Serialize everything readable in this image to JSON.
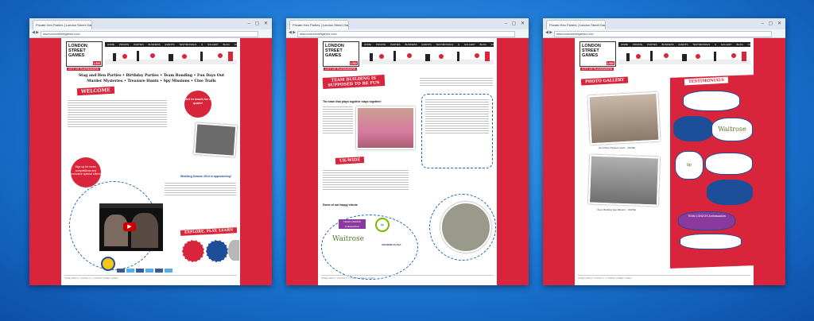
{
  "windows": [
    {
      "tab_title": "Private Hen Parties | London Street Games",
      "url": "www.londonstreetgames.com/",
      "nav": "HOME  PRIVATE PARTIES  BUSINESS EVENTS  TESTIMONIALS & GALLERY  BLOG  CONTACT",
      "logo": {
        "line1": "LONDON",
        "line2": "STREET",
        "line3": "GAMES",
        "badge": "LSG",
        "tagline": "CITY OF PLAYMAKERS"
      },
      "headline": "Stag and Hen Parties • Birthday Parties • Team Bonding • Fun Days Out",
      "headline2": "Murder Mysteries • Treasure Hunts • Spy Missions • Clue Trails",
      "welcome": "WELCOME",
      "get_in_touch": "Get in touch for a quote!",
      "signup": "Sign up for news, competitions and exclusive special offers!",
      "explore": "EXPLORE, PLAY, LEARN",
      "wedding": "Wedding Season 2014 is approaching!"
    },
    {
      "tab_title": "Private Hen Parties | London Street Games",
      "url": "www.londonstreetgames.com/",
      "nav": "HOME  PRIVATE PARTIES  BUSINESS EVENTS  TESTIMONIALS & GALLERY  BLOG  CONTACT",
      "heading": "TEAM BUILDING IS SUPPOSED TO BE FUN",
      "subheading": "The team that plays together stays together!",
      "uswide": "UK-WIDE",
      "clients_heading": "Some of our happy clients",
      "clients": [
        "TEAM LONDON Ambassadors",
        "bp",
        "Waitrose",
        "CROWNE PLAZA"
      ]
    },
    {
      "tab_title": "Private Hen Parties | London Street Games",
      "url": "www.londonstreetgames.com/",
      "nav": "HOME  PRIVATE PARTIES  BUSINESS EVENTS  TESTIMONIALS & GALLERY  BLOG  CONTACT",
      "gallery": "PHOTO GALLERY",
      "testimonials": "TESTIMONIALS",
      "captions": [
        "Hen Party Treasure Hunt... (DATE)",
        "Team Building Spy Mission... (DATE)"
      ],
      "brands": [
        "Waitrose",
        "bp",
        "TEAM LONDON Ambassadors"
      ]
    }
  ]
}
